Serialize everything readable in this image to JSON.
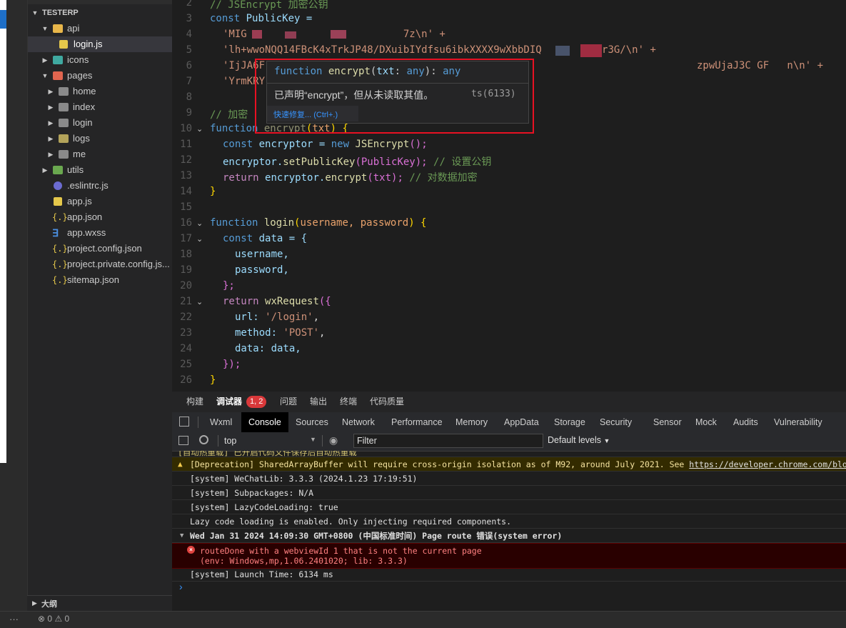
{
  "explorer": {
    "project": "TESTERP",
    "items": [
      {
        "label": "api",
        "chev": "▼"
      },
      {
        "label": "login.js"
      },
      {
        "label": "icons",
        "chev": "▶"
      },
      {
        "label": "pages",
        "chev": "▼"
      },
      {
        "label": "home",
        "chev": "▶"
      },
      {
        "label": "index",
        "chev": "▶"
      },
      {
        "label": "login",
        "chev": "▶"
      },
      {
        "label": "logs",
        "chev": "▶"
      },
      {
        "label": "me",
        "chev": "▶"
      },
      {
        "label": "utils",
        "chev": "▶"
      },
      {
        "label": ".eslintrc.js"
      },
      {
        "label": "app.js"
      },
      {
        "label": "app.json"
      },
      {
        "label": "app.wxss"
      },
      {
        "label": "project.config.json"
      },
      {
        "label": "project.private.config.js..."
      },
      {
        "label": "sitemap.json"
      }
    ],
    "outline": "大纲"
  },
  "editor": {
    "line_numbers": [
      "2",
      "3",
      "4",
      "5",
      "6",
      "7",
      "8",
      "9",
      "10",
      "11",
      "12",
      "13",
      "14",
      "15",
      "16",
      "17",
      "18",
      "19",
      "20",
      "21",
      "22",
      "23",
      "24",
      "25",
      "26"
    ],
    "lines": {
      "l2": "// JSEncrypt 加密公钥",
      "l3a": "const",
      "l3b": "PublicKey =",
      "l4": "'MIG                          7z\\n' +",
      "l5": "'lh+wwoNQQ14FBcK4xTrkJP48/DXuibIYdfsu6ibkXXXX9wXbbDIQ          r3G/\\n' +",
      "l6a": "'IjJA6F",
      "l6b": "zpwUjaJ3C GF   n\\n' +",
      "l7": "'YrmKRY",
      "l9": "// 加密",
      "l10a": "function",
      "l10b": "encrypt",
      "l10c": "(",
      "l10d": "txt",
      "l10e": ") {",
      "l11a": "const",
      "l11b": "encryptor = ",
      "l11c": "new",
      "l11d": "JSEncrypt",
      "l11e": "();",
      "l12a": "encryptor.",
      "l12b": "setPublicKey",
      "l12c": "(PublicKey);",
      "l12d": "// 设置公钥",
      "l13a": "return",
      "l13b": "encryptor.",
      "l13c": "encrypt",
      "l13d": "(txt);",
      "l13e": "// 对数据加密",
      "l14": "}",
      "l16a": "function",
      "l16b": "login",
      "l16c": "(",
      "l16d": "username, password",
      "l16e": ") {",
      "l17a": "const",
      "l17b": "data = {",
      "l18": "username,",
      "l19": "password,",
      "l20": "};",
      "l21a": "return",
      "l21b": "wxRequest",
      "l21c": "({",
      "l22a": "url: ",
      "l22b": "'/login'",
      "l22c": ",",
      "l23a": "method: ",
      "l23b": "'POST'",
      "l23c": ",",
      "l24": "data: data,",
      "l25": "});",
      "l26": "}"
    }
  },
  "tooltip": {
    "sig_kw": "function",
    "sig_name": "encrypt",
    "sig_rest1": "(",
    "sig_param": "txt",
    "sig_colon": ": ",
    "sig_type": "any",
    "sig_rest2": "): ",
    "sig_ret": "any",
    "message": "已声明“encrypt”，但从未读取其值。",
    "code": "ts(6133)",
    "quickfix": "快速修复... (Ctrl+.)"
  },
  "panel_tabs": {
    "build": "构建",
    "debugger": "调试器",
    "badge": "1, 2",
    "issues": "问题",
    "output": "输出",
    "terminal": "终端",
    "quality": "代码质量"
  },
  "devtools_tabs": [
    "Wxml",
    "Console",
    "Sources",
    "Network",
    "Performance",
    "Memory",
    "AppData",
    "Storage",
    "Security",
    "Sensor",
    "Mock",
    "Audits",
    "Vulnerability"
  ],
  "console_toolbar": {
    "context": "top",
    "filter_placeholder": "Filter",
    "levels": "Default levels"
  },
  "console": {
    "cut_line": "[自动热重载] 已开启代码文件保存后自动热重载",
    "deprecation": "[Deprecation] SharedArrayBuffer will require cross-origin isolation as of M92, around July 2021. See ",
    "deprecation_link": "https://developer.chrome.com/blog/enabl",
    "wechatlib": "[system] WeChatLib: 3.3.3 (2024.1.23 17:19:51)",
    "subpackages": "[system] Subpackages: N/A",
    "lazy": "[system] LazyCodeLoading: true",
    "lazy2": "Lazy code loading is enabled. Only injecting required components.",
    "group": "Wed Jan 31 2024 14:09:30 GMT+0800 (中国标准时间) Page route 错误(system error)",
    "error1": "routeDone with a webviewId 1 that is not the current page",
    "error2": "(env: Windows,mp,1.06.2401020; lib: 3.3.3)",
    "launch": "[system] Launch Time: 6134 ms",
    "prompt": "›"
  },
  "statusbar": {
    "dots": "···",
    "errors": "0",
    "warnings": "0"
  }
}
